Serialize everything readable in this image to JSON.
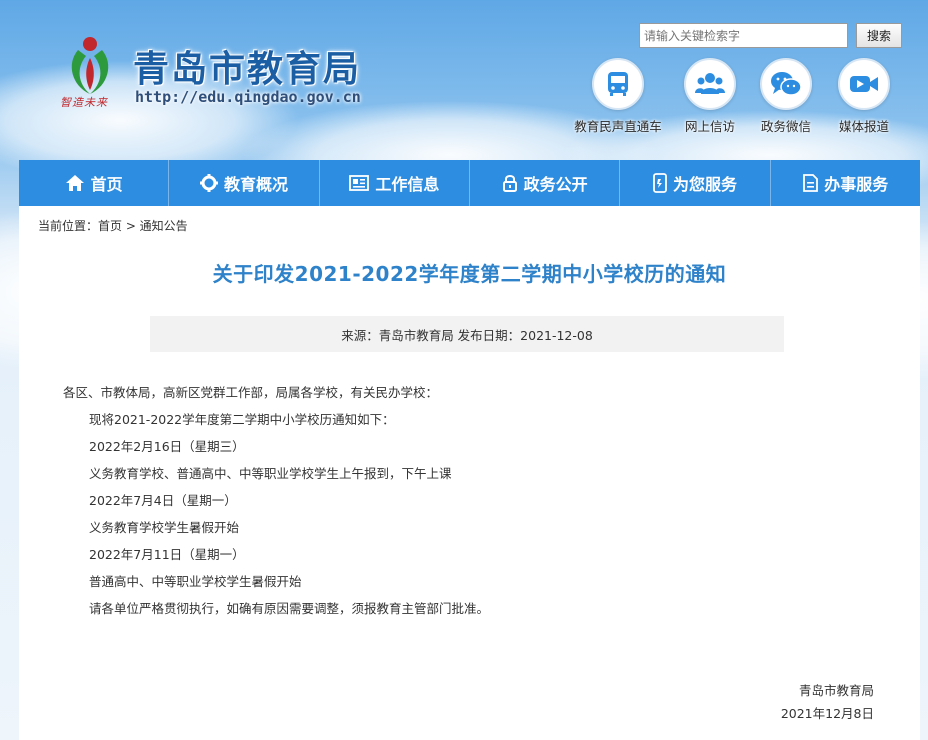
{
  "header": {
    "site_title": "青岛市教育局",
    "site_url": "http://edu.qingdao.gov.cn",
    "slogan": "智造未来",
    "search_placeholder": "请输入关键检索字",
    "search_button": "搜索",
    "quick_links": [
      {
        "label": "教育民声直通车",
        "icon": "bus-icon"
      },
      {
        "label": "网上信访",
        "icon": "people-icon"
      },
      {
        "label": "政务微信",
        "icon": "wechat-icon"
      },
      {
        "label": "媒体报道",
        "icon": "video-icon"
      }
    ]
  },
  "nav": {
    "items": [
      {
        "label": "首页",
        "icon": "home-icon"
      },
      {
        "label": "教育概况",
        "icon": "gear-icon"
      },
      {
        "label": "工作信息",
        "icon": "newspaper-icon"
      },
      {
        "label": "政务公开",
        "icon": "lock-icon"
      },
      {
        "label": "为您服务",
        "icon": "phone-icon"
      },
      {
        "label": "办事服务",
        "icon": "document-icon"
      }
    ]
  },
  "breadcrumb": "当前位置：首页 > 通知公告",
  "article": {
    "title": "关于印发2021-2022学年度第二学期中小学校历的通知",
    "meta": "来源：青岛市教育局 发布日期：2021-12-08",
    "paragraphs": [
      "各区、市教体局，高新区党群工作部，局属各学校，有关民办学校：",
      "现将2021-2022学年度第二学期中小学校历通知如下：",
      "2022年2月16日（星期三）",
      "义务教育学校、普通高中、中等职业学校学生上午报到，下午上课",
      "2022年7月4日（星期一）",
      "义务教育学校学生暑假开始",
      "2022年7月11日（星期一）",
      "普通高中、中等职业学校学生暑假开始",
      "请各单位严格贯彻执行，如确有原因需要调整，须报教育主管部门批准。"
    ],
    "signature_org": "青岛市教育局",
    "signature_date": "2021年12月8日"
  },
  "colors": {
    "nav_bg": "#2d8de0",
    "title_blue": "#2e82c9",
    "logo_red": "#c0282d",
    "logo_green": "#2e9a3e",
    "site_title": "#1c5ea3"
  }
}
